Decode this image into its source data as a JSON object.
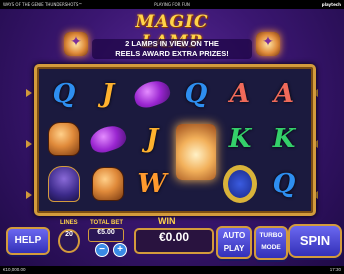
{
  "top_bar": {
    "game_title": "WAYS OF THE GENIE THUNDERSHOTS™",
    "mode": "PLAYING FOR FUN",
    "brand": "playtech"
  },
  "header": {
    "logo": "MAGIC LAMP",
    "banner_line1": "2 LAMPS IN VIEW ON THE",
    "banner_line2": "REELS AWARD EXTRA PRIZES!"
  },
  "reels": [
    [
      "Q",
      "jar",
      "genie"
    ],
    [
      "J",
      "sack",
      "jar"
    ],
    [
      "sack",
      "J",
      "W"
    ],
    [
      "Q",
      "lamp-glow",
      ""
    ],
    [
      "A",
      "K",
      "ring"
    ],
    [
      "A",
      "K",
      "Q"
    ]
  ],
  "symbol_colors": {
    "Q": "#2e8ef0",
    "J": "#ffb22e",
    "K": "#34d06a",
    "A": "#f06a5a",
    "W": "#ff9a2e"
  },
  "controls": {
    "help": "HELP",
    "lines_label": "LINES",
    "lines_value": "20",
    "total_bet_label": "TOTAL BET",
    "total_bet_value": "€5.00",
    "minus": "−",
    "plus": "+",
    "win_label": "WIN",
    "win_value": "€0.00",
    "auto_play_line1": "AUTO",
    "auto_play_line2": "PLAY",
    "turbo_line1": "TURBO",
    "turbo_line2": "MODE",
    "spin": "SPIN"
  },
  "bottom_bar": {
    "balance": "€10,000.00",
    "time": "17:30"
  }
}
